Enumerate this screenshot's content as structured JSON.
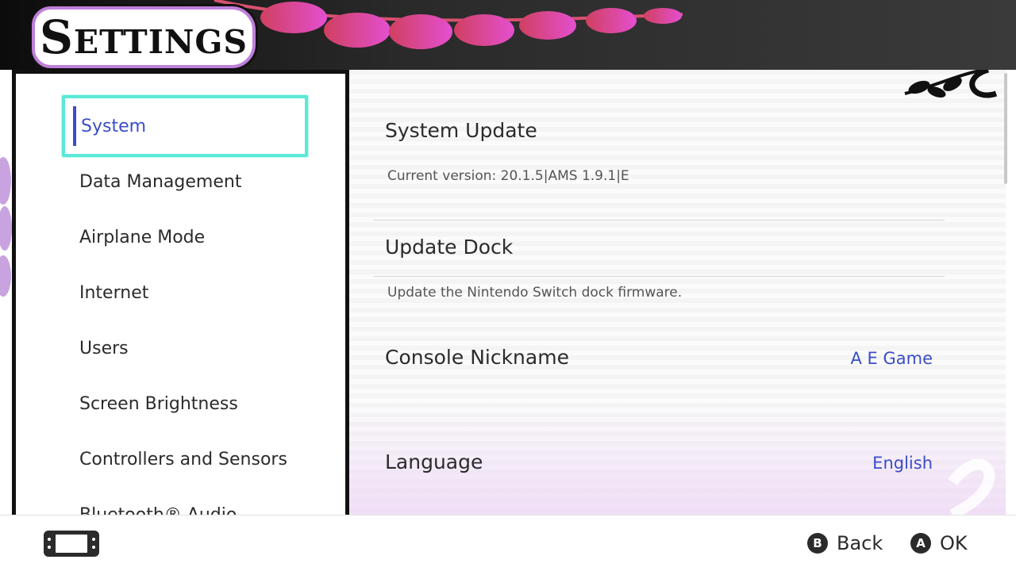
{
  "header": {
    "title": "Settings"
  },
  "sidebar": {
    "items": [
      {
        "label": "System",
        "selected": true
      },
      {
        "label": "Data Management"
      },
      {
        "label": "Airplane Mode"
      },
      {
        "label": "Internet"
      },
      {
        "label": "Users"
      },
      {
        "label": "Screen Brightness"
      },
      {
        "label": "Controllers and Sensors"
      },
      {
        "label": "Bluetooth® Audio"
      }
    ]
  },
  "main": {
    "system_update": {
      "title": "System Update",
      "description": "Current version: 20.1.5|AMS 1.9.1|E"
    },
    "update_dock": {
      "title": "Update Dock",
      "description": "Update the Nintendo Switch dock firmware."
    },
    "console_nickname": {
      "title": "Console Nickname",
      "value": "A E Game"
    },
    "language": {
      "title": "Language",
      "value": "English"
    }
  },
  "footer": {
    "back": {
      "button": "B",
      "label": "Back"
    },
    "ok": {
      "button": "A",
      "label": "OK"
    }
  },
  "colors": {
    "accent": "#3b4dc9",
    "selection_border": "#5ce8d6",
    "header_bg": "#1a1a1a",
    "title_plate_border": "#bf7fda"
  },
  "icons": {
    "console": "handheld-console-icon"
  }
}
